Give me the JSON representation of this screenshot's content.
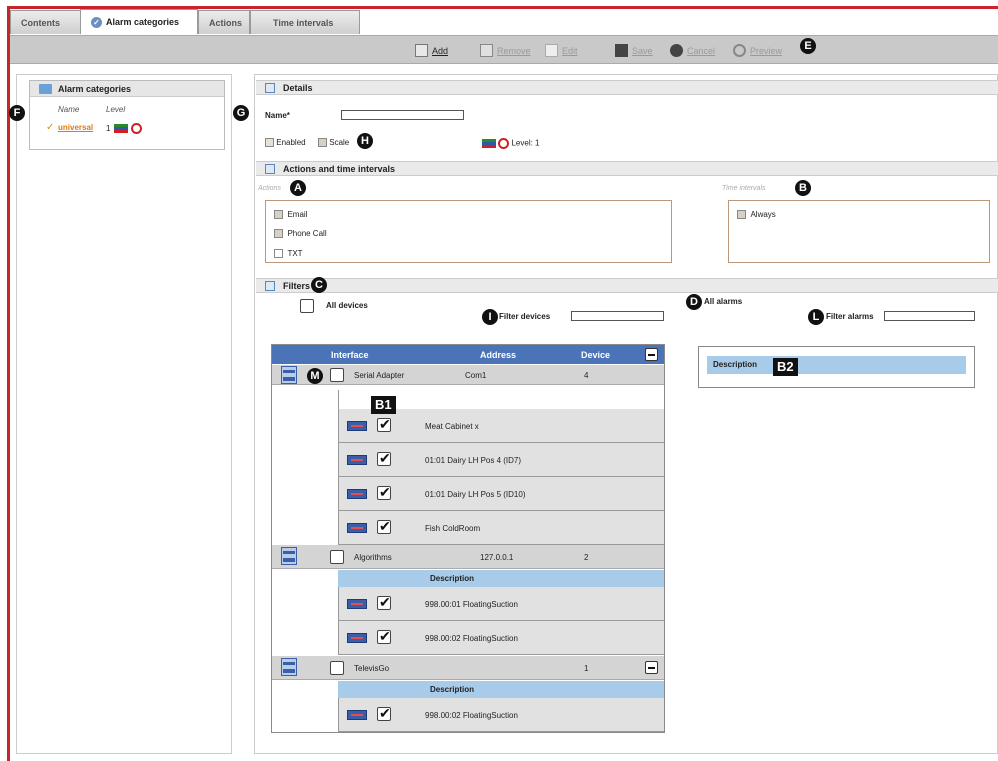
{
  "tabs": [
    {
      "label": "Contents"
    },
    {
      "label": "Alarm categories"
    },
    {
      "label": "Actions"
    },
    {
      "label": "Time intervals"
    }
  ],
  "toolbar": {
    "add": "Add",
    "remove": "Remove",
    "edit": "Edit",
    "save": "Save",
    "cancel": "Cancel",
    "preview": "Preview"
  },
  "badges": {
    "a": "A",
    "b": "B",
    "c": "C",
    "d": "D",
    "e": "E",
    "f": "F",
    "g": "G",
    "h": "H",
    "i": "I",
    "l": "L",
    "m": "M",
    "b1": "B1",
    "b2": "B2"
  },
  "categories": {
    "title": "Alarm categories",
    "col_name": "Name",
    "col_level": "Level",
    "item_name": "universal",
    "item_level": "1"
  },
  "details": {
    "title": "Details",
    "name_label": "Name*",
    "name_value": "",
    "enabled_label": "Enabled",
    "scale_label": "Scale",
    "level_text": "Level: 1"
  },
  "actions_section": {
    "title": "Actions and time intervals",
    "actions_label": "Actions",
    "time_label": "Time intervals",
    "actions": [
      "Email",
      "Phone Call",
      "TXT"
    ],
    "intervals": [
      "Always"
    ]
  },
  "filters": {
    "title": "Filters",
    "all_devices": "All devices",
    "filter_devices": "Filter devices",
    "all_alarms": "All alarms",
    "filter_alarms": "Filter alarms",
    "alarm_desc_header": "Description"
  },
  "device_table": {
    "headers": {
      "interface": "Interface",
      "address": "Address",
      "device": "Device"
    },
    "groups": [
      {
        "interface": "Serial Adapter",
        "address": "Com1",
        "device": "4",
        "items": [
          "Meat Cabinet x",
          "01:01 Dairy LH Pos 4 (ID7)",
          "01:01 Dairy LH Pos 5 (ID10)",
          "Fish ColdRoom"
        ]
      },
      {
        "interface": "Algorithms",
        "address": "127.0.0.1",
        "device": "2",
        "desc_header": "Description",
        "items": [
          "998.00:01 FloatingSuction",
          "998.00:02 FloatingSuction"
        ]
      },
      {
        "interface": "TelevisGo",
        "address": "",
        "device": "1",
        "desc_header": "Description",
        "items": [
          "998.00:02 FloatingSuction"
        ]
      }
    ]
  }
}
